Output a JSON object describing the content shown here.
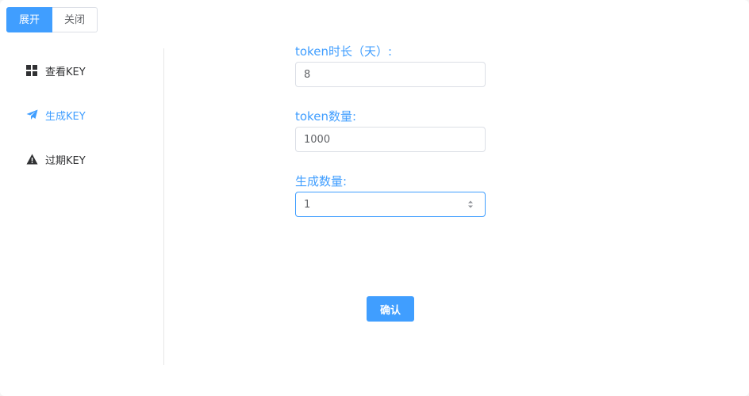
{
  "toggle": {
    "expand_label": "展开",
    "collapse_label": "关闭"
  },
  "sidebar": {
    "items": [
      {
        "label": "查看KEY",
        "icon": "grid-icon"
      },
      {
        "label": "生成KEY",
        "icon": "paper-plane-icon",
        "active": true
      },
      {
        "label": "过期KEY",
        "icon": "warning-icon"
      }
    ]
  },
  "form": {
    "token_duration": {
      "label": "token时长（天）:",
      "value": "8"
    },
    "token_count": {
      "label": "token数量:",
      "value": "1000"
    },
    "generate_count": {
      "label": "生成数量:",
      "value": "1"
    },
    "confirm_label": "确认"
  },
  "colors": {
    "accent": "#409eff",
    "text": "#303133",
    "border": "#dcdfe6"
  }
}
